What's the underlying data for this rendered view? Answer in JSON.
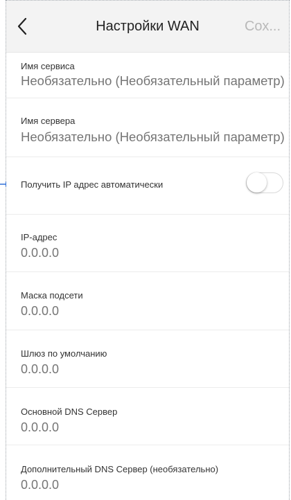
{
  "header": {
    "title": "Настройки WAN",
    "save_label": "Сох..."
  },
  "fields": [
    {
      "label": "Имя сервиса",
      "placeholder": "Необязательно (Необязательный параметр)"
    },
    {
      "label": "Имя сервера",
      "placeholder": "Необязательно (Необязательный параметр)"
    },
    {
      "label": "Получить IP адрес автоматически",
      "toggle_on": false
    },
    {
      "label": "IP-адрес",
      "placeholder": "0.0.0.0"
    },
    {
      "label": "Маска подсети",
      "placeholder": "0.0.0.0"
    },
    {
      "label": "Шлюз по умолчанию",
      "placeholder": "0.0.0.0"
    },
    {
      "label": "Основной DNS Сервер",
      "placeholder": "0.0.0.0"
    },
    {
      "label": "Дополнительный DNS Сервер (необязательно)",
      "placeholder": "0.0.0.0"
    }
  ],
  "colors": {
    "header_bg": "#f3f3f3",
    "placeholder": "#c6c6c6",
    "save_disabled": "#b9b9b9",
    "pointer_arrow": "#2f6fd6"
  },
  "icons": {
    "back": "chevron-left-icon",
    "pointer": "arrow-right-icon"
  }
}
